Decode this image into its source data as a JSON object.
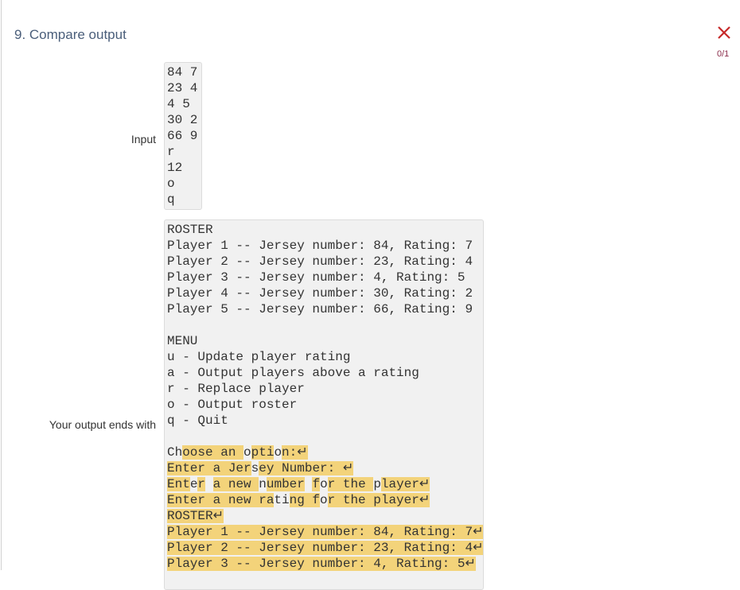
{
  "header": {
    "title": "9. Compare output",
    "score": "0/1",
    "status_icon": "close-icon",
    "status_color": "#c62828"
  },
  "input": {
    "label": "Input",
    "lines": [
      "84 7",
      "23 4",
      "4 5",
      "30 2",
      "66 9",
      "r",
      "12",
      "o",
      "q"
    ]
  },
  "output": {
    "label": "Your output ends with",
    "plain_lines": [
      "ROSTER",
      "Player 1 -- Jersey number: 84, Rating: 7",
      "Player 2 -- Jersey number: 23, Rating: 4",
      "Player 3 -- Jersey number: 4, Rating: 5",
      "Player 4 -- Jersey number: 30, Rating: 2",
      "Player 5 -- Jersey number: 66, Rating: 9",
      "",
      "MENU",
      "u - Update player rating",
      "a - Output players above a rating",
      "r - Replace player",
      "o - Output roster",
      "q - Quit",
      ""
    ],
    "diff_lines": [
      {
        "segments": [
          {
            "t": "Ch",
            "hl": false
          },
          {
            "t": "oose an ",
            "hl": true
          },
          {
            "t": "o",
            "hl": false
          },
          {
            "t": "pti",
            "hl": true
          },
          {
            "t": "o",
            "hl": false
          },
          {
            "t": "n:↵",
            "hl": true
          }
        ]
      },
      {
        "segments": [
          {
            "t": "Enter a Jer",
            "hl": true
          },
          {
            "t": "s",
            "hl": false
          },
          {
            "t": "ey Number: ↵",
            "hl": true
          }
        ]
      },
      {
        "segments": [
          {
            "t": "Ent",
            "hl": true
          },
          {
            "t": "e",
            "hl": false
          },
          {
            "t": "r",
            "hl": true
          },
          {
            "t": " ",
            "hl": false
          },
          {
            "t": "a new ",
            "hl": true
          },
          {
            "t": "n",
            "hl": false
          },
          {
            "t": "umber",
            "hl": true
          },
          {
            "t": " ",
            "hl": false
          },
          {
            "t": "f",
            "hl": true
          },
          {
            "t": "o",
            "hl": false
          },
          {
            "t": "r the ",
            "hl": true
          },
          {
            "t": "p",
            "hl": false
          },
          {
            "t": "layer↵",
            "hl": true
          }
        ]
      },
      {
        "segments": [
          {
            "t": "Enter a new ra",
            "hl": true
          },
          {
            "t": "ti",
            "hl": false
          },
          {
            "t": "ng f",
            "hl": true
          },
          {
            "t": "o",
            "hl": false
          },
          {
            "t": "r the player↵",
            "hl": true
          }
        ]
      },
      {
        "segments": [
          {
            "t": "ROSTER↵",
            "hl": true
          }
        ]
      },
      {
        "segments": [
          {
            "t": "Player 1 -- Jersey number: 84, Rating: 7↵",
            "hl": true
          }
        ]
      },
      {
        "segments": [
          {
            "t": "Player 2 -- Jersey number: 23, Rating: 4↵",
            "hl": true
          }
        ]
      },
      {
        "segments": [
          {
            "t": "Player 3 -- Jersey number: 4, Rating: 5↵",
            "hl": true
          }
        ]
      }
    ]
  }
}
